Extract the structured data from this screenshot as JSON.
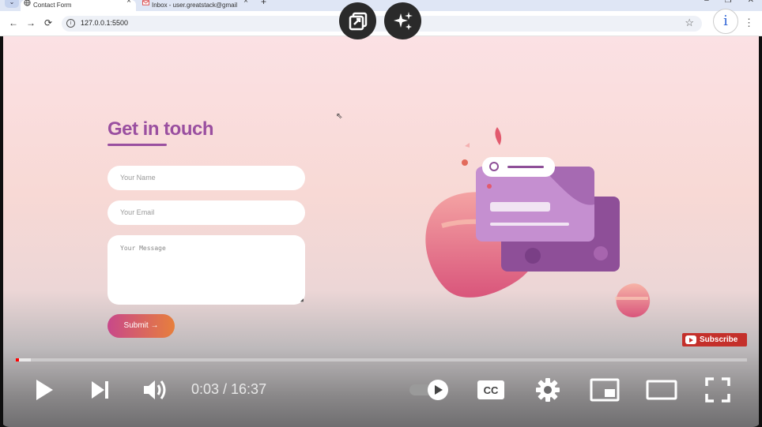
{
  "browser": {
    "tabs": [
      {
        "title": "Contact Form",
        "close": "×"
      },
      {
        "title": "Inbox - user.greatstack@gmail",
        "close": "×"
      }
    ],
    "new_tab": "+",
    "window_controls": [
      "–",
      "❐",
      "✕"
    ],
    "tab_list": "⌄",
    "nav": {
      "back": "←",
      "forward": "→",
      "reload": "⟳"
    },
    "url": "127.0.0.1:5500",
    "star": "☆",
    "menu": "⋮"
  },
  "form": {
    "heading": "Get in touch",
    "name_placeholder": "Your Name",
    "email_placeholder": "Your Email",
    "message_placeholder": "Your Message",
    "submit_label": "Submit",
    "submit_arrow": "→"
  },
  "youtube": {
    "subscribe_label": "Subscribe",
    "info": "i"
  },
  "player": {
    "current_time": "0:03",
    "duration": "16:37",
    "time_display": "0:03 / 16:37",
    "progress_fraction": 0.003,
    "buffered_fraction": 0.02,
    "autoplay": true
  },
  "colors": {
    "accent": "#9a4fa0",
    "submit_start": "#c8488a",
    "submit_end": "#e77f3c",
    "progress": "#ff0000",
    "subscribe": "#c4302b"
  },
  "icons": [
    "share-icon",
    "ai-sparkle-icon",
    "play-icon",
    "next-icon",
    "volume-icon",
    "autoplay-toggle-icon",
    "captions-icon",
    "settings-icon",
    "miniplayer-icon",
    "theater-icon",
    "fullscreen-icon"
  ]
}
